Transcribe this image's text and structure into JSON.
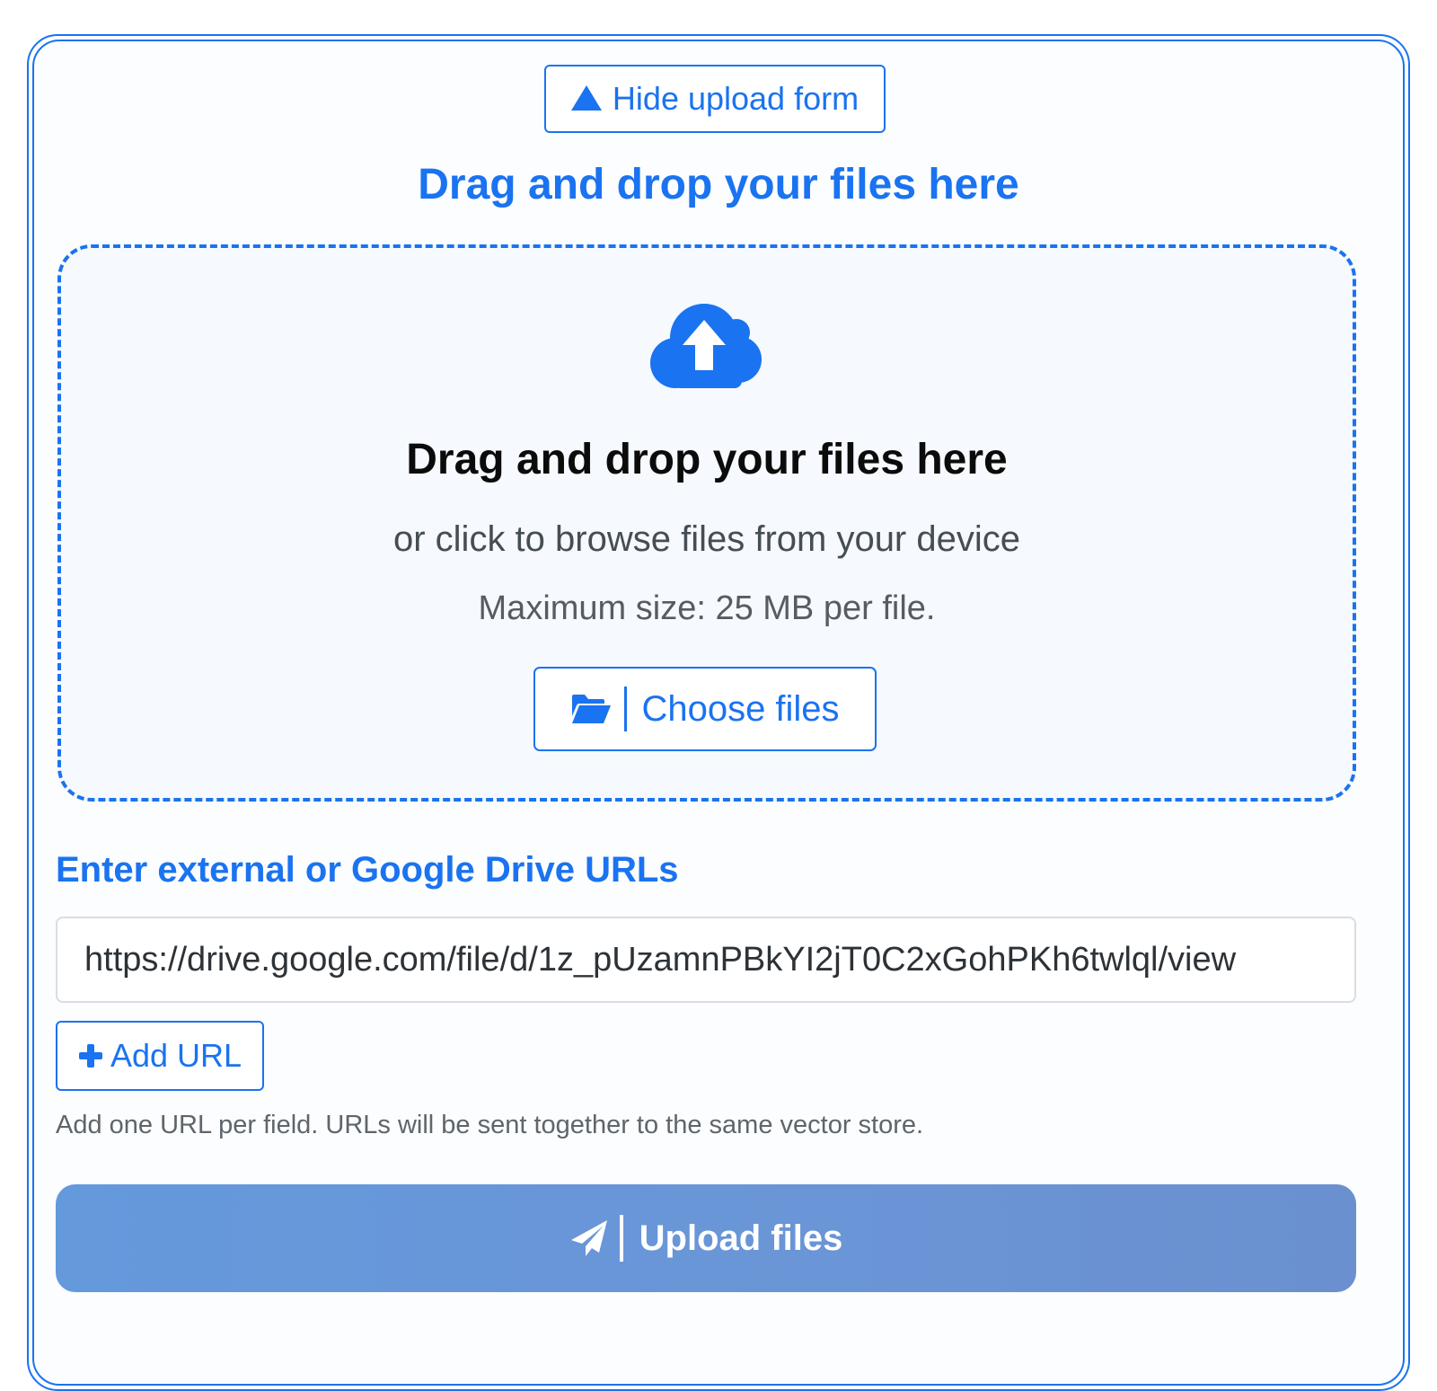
{
  "toggle": {
    "label": "Hide upload form",
    "icon": "triangle-up-icon"
  },
  "drop_heading": "Drag and drop your files here",
  "dropzone": {
    "icon": "cloud-upload-icon",
    "title": "Drag and drop your files here",
    "subtitle": "or click to browse files from your device",
    "max_size": "Maximum size: 25 MB per file.",
    "choose_label": "Choose files",
    "choose_icon": "folder-open-icon"
  },
  "urls": {
    "heading": "Enter external or Google Drive URLs",
    "value": "https://drive.google.com/file/d/1z_pUzamnPBkYI2jT0C2xGohPKh6twlql/view",
    "add_label": "Add URL",
    "add_icon": "plus-icon",
    "help": "Add one URL per field. URLs will be sent together to the same vector store."
  },
  "upload": {
    "label": "Upload files",
    "icon": "paper-plane-icon"
  },
  "colors": {
    "accent": "#1a73f0",
    "upload_button": "#6697d9",
    "dropzone_bg": "#f6f9fd"
  }
}
